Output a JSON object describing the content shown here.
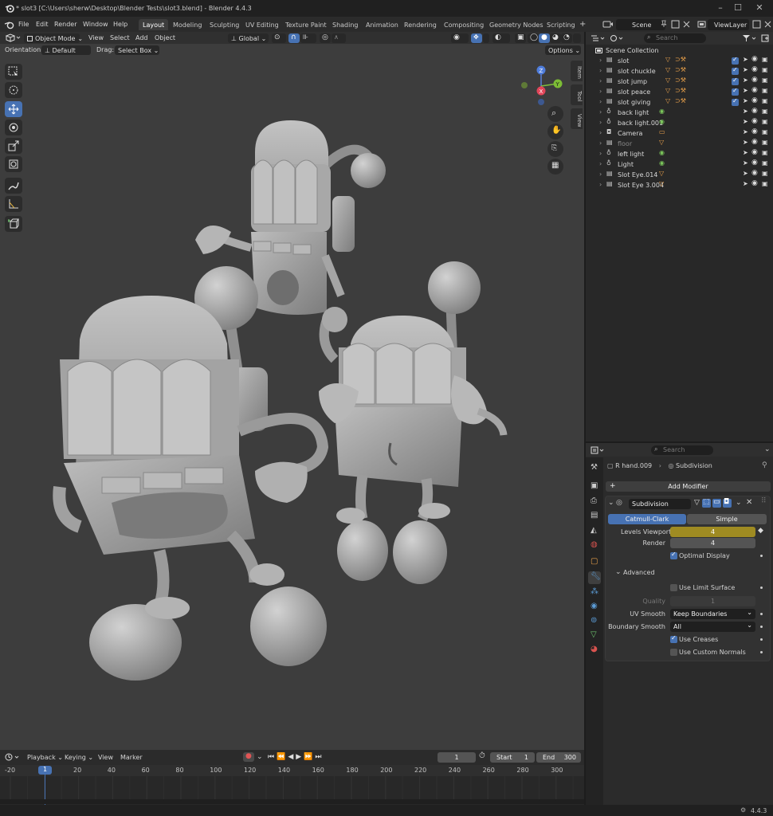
{
  "window": {
    "title": "* slot3 [C:\\Users\\sherw\\Desktop\\Blender Tests\\slot3.blend] - Blender 4.4.3",
    "minimize": "–",
    "maximize": "☐",
    "close": "✕"
  },
  "menu": [
    "File",
    "Edit",
    "Render",
    "Window",
    "Help"
  ],
  "workspaces": [
    "Layout",
    "Modeling",
    "Sculpting",
    "UV Editing",
    "Texture Paint",
    "Shading",
    "Animation",
    "Rendering",
    "Compositing",
    "Geometry Nodes",
    "Scripting"
  ],
  "workspace_add": "+",
  "scene": {
    "name": "Scene",
    "view_layer": "ViewLayer"
  },
  "viewport": {
    "mode": "Object Mode",
    "menus": [
      "View",
      "Select",
      "Add",
      "Object"
    ],
    "transform_orientation": "Global",
    "orientation_label": "Orientation:",
    "orientation_value": "Default",
    "drag_label": "Drag:",
    "drag_value": "Select Box",
    "options": "Options",
    "side_tabs": [
      "Item",
      "Tool",
      "View"
    ],
    "gizmo": {
      "z": "Z",
      "y": "Y",
      "x": "X"
    }
  },
  "outliner": {
    "search_placeholder": "Search",
    "root": "Scene Collection",
    "items": [
      {
        "name": "slot",
        "type": "mesh"
      },
      {
        "name": "slot chuckle",
        "type": "mesh"
      },
      {
        "name": "slot jump",
        "type": "mesh"
      },
      {
        "name": "slot peace",
        "type": "mesh"
      },
      {
        "name": "slot giving",
        "type": "mesh"
      },
      {
        "name": "back light",
        "type": "light"
      },
      {
        "name": "back light.001",
        "type": "light"
      },
      {
        "name": "Camera",
        "type": "camera"
      },
      {
        "name": "floor",
        "type": "mesh"
      },
      {
        "name": "left light",
        "type": "light"
      },
      {
        "name": "Light",
        "type": "light"
      },
      {
        "name": "Slot Eye.014",
        "type": "mesh"
      },
      {
        "name": "Slot Eye 3.004",
        "type": "mesh"
      }
    ]
  },
  "properties": {
    "search_placeholder": "Search",
    "breadcrumb_object": "R hand.009",
    "breadcrumb_sep": "›",
    "breadcrumb_modifier": "Subdivision",
    "add_modifier": "Add Modifier",
    "add_icon": "+",
    "modifier_name": "Subdivision",
    "catmull_clark": "Catmull-Clark",
    "simple": "Simple",
    "levels_viewport_label": "Levels Viewport",
    "levels_viewport_value": "4",
    "render_label": "Render",
    "render_value": "4",
    "optimal_display": "Optimal Display",
    "advanced": "Advanced",
    "use_limit_surface": "Use Limit Surface",
    "quality_label": "Quality",
    "quality_value": "1",
    "uv_smooth_label": "UV Smooth",
    "uv_smooth_value": "Keep Boundaries",
    "boundary_smooth_label": "Boundary Smooth",
    "boundary_smooth_value": "All",
    "use_creases": "Use Creases",
    "use_custom_normals": "Use Custom Normals"
  },
  "timeline": {
    "menus": [
      "Playback",
      "Keying",
      "View",
      "Marker"
    ],
    "current_frame": "1",
    "start_label": "Start",
    "start_value": "1",
    "end_label": "End",
    "end_value": "300",
    "playhead": "1",
    "ticks": [
      "-20",
      "20",
      "40",
      "60",
      "80",
      "100",
      "120",
      "140",
      "160",
      "180",
      "200",
      "220",
      "240",
      "260",
      "280",
      "300"
    ]
  },
  "status": {
    "version": "4.4.3"
  },
  "colors": {
    "accent": "#4772b3",
    "keyframe_yellow": "#9f8b22",
    "mesh_orange": "#e8a04a",
    "light_green": "#7ac55a"
  }
}
